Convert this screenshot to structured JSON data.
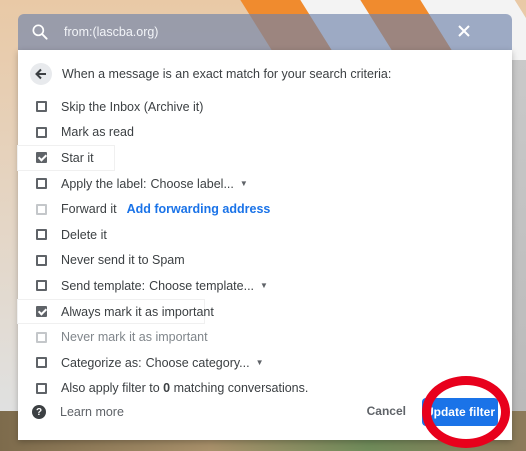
{
  "search": {
    "query": "from:(lascba.org)"
  },
  "header": {
    "text": "When a message is an exact match for your search criteria:"
  },
  "options": [
    {
      "label": "Skip the Inbox (Archive it)",
      "checked": false,
      "disabled": false
    },
    {
      "label": "Mark as read",
      "checked": false,
      "disabled": false
    },
    {
      "label": "Star it",
      "checked": true,
      "disabled": false
    },
    {
      "label": "Apply the label:",
      "dropdown": "Choose label...",
      "checked": false,
      "disabled": false
    },
    {
      "label": "Forward it",
      "link": "Add forwarding address",
      "checked": false,
      "disabled": true
    },
    {
      "label": "Delete it",
      "checked": false,
      "disabled": false
    },
    {
      "label": "Never send it to Spam",
      "checked": false,
      "disabled": false
    },
    {
      "label": "Send template:",
      "dropdown": "Choose template...",
      "checked": false,
      "disabled": false
    },
    {
      "label": "Always mark it as important",
      "checked": true,
      "disabled": false
    },
    {
      "label": "Never mark it as important",
      "checked": false,
      "disabled": true
    },
    {
      "label": "Categorize as:",
      "dropdown": "Choose category...",
      "checked": false,
      "disabled": false
    },
    {
      "label_prefix": "Also apply filter to ",
      "count": "0",
      "label_suffix": " matching conversations.",
      "checked": false,
      "disabled": false
    }
  ],
  "footer": {
    "learn_more": "Learn more",
    "cancel": "Cancel",
    "update": "Update filter"
  },
  "colors": {
    "accent": "#1a73e8",
    "annotation": "#e8001c"
  }
}
